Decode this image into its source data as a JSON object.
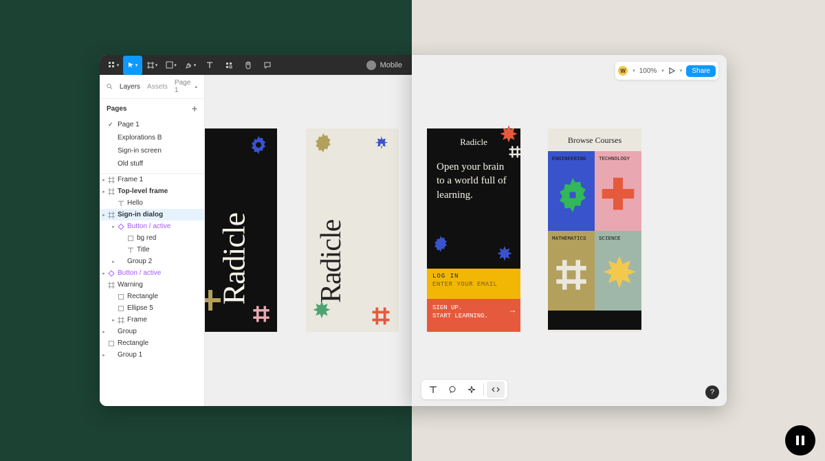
{
  "toolbar": {
    "project_name": "Mobile"
  },
  "left_tabs": {
    "layers": "Layers",
    "assets": "Assets",
    "page_selector": "Page 1"
  },
  "pages": {
    "title": "Pages",
    "items": [
      {
        "label": "Page 1",
        "active": true
      },
      {
        "label": "Explorations B",
        "active": false
      },
      {
        "label": "Sign-in screen",
        "active": false
      },
      {
        "label": "Old stuff",
        "active": false
      }
    ]
  },
  "layers": [
    {
      "label": "Frame 1",
      "depth": 0,
      "icon": "frame",
      "bold": false,
      "disc": true
    },
    {
      "label": "Top-level frame",
      "depth": 0,
      "icon": "frame",
      "bold": true,
      "disc": true
    },
    {
      "label": "Hello",
      "depth": 1,
      "icon": "text",
      "bold": false
    },
    {
      "label": "Sign-in dialog",
      "depth": 0,
      "icon": "frame",
      "bold": true,
      "selected": true,
      "disc": true
    },
    {
      "label": "Button / active",
      "depth": 1,
      "icon": "component",
      "bold": false,
      "purple": true,
      "disc": true
    },
    {
      "label": "bg red",
      "depth": 2,
      "icon": "rect",
      "bold": false
    },
    {
      "label": "Title",
      "depth": 2,
      "icon": "text",
      "bold": false
    },
    {
      "label": "Group 2",
      "depth": 1,
      "icon": "none",
      "bold": false,
      "disc": true
    },
    {
      "label": "Button / active",
      "depth": 0,
      "icon": "component",
      "bold": false,
      "purple": true,
      "disc": true
    },
    {
      "label": "Warning",
      "depth": 0,
      "icon": "frame",
      "bold": false
    },
    {
      "label": "Rectangle",
      "depth": 1,
      "icon": "rect",
      "bold": false
    },
    {
      "label": "Ellipse 5",
      "depth": 1,
      "icon": "rect",
      "bold": false
    },
    {
      "label": "Frame",
      "depth": 1,
      "icon": "frame",
      "bold": false,
      "disc": true
    },
    {
      "label": "Group",
      "depth": 0,
      "icon": "none",
      "bold": false,
      "disc": true
    },
    {
      "label": "Rectangle",
      "depth": 0,
      "icon": "rect",
      "bold": false
    },
    {
      "label": "Group 1",
      "depth": 0,
      "icon": "none",
      "bold": false,
      "disc": true
    }
  ],
  "viewer": {
    "badge": "W",
    "zoom": "100%",
    "share": "Share"
  },
  "canvas": {
    "radicle": "Radicle",
    "frame3": {
      "brand": "Radicle",
      "headline": "Open your brain to a world full of learning.",
      "login_label": "LOG IN",
      "login_placeholder": "ENTER YOUR EMAIL",
      "signup_line1": "SIGN UP.",
      "signup_line2": "START LEARNING."
    },
    "frame4": {
      "title": "Browse Courses",
      "cells": {
        "engineering": "ENGINEERING",
        "technology": "TECHNOLOGY",
        "mathematics": "MATHEMATICS",
        "science": "SCIENCE"
      }
    }
  },
  "help": "?",
  "colors": {
    "figma_blue": "#0d99ff",
    "dark_green": "#1c4233",
    "beige": "#e5e1da",
    "yellow": "#f2b705",
    "orange": "#e55a3c",
    "royal_blue": "#3853cc",
    "pink": "#e9a8b1",
    "olive": "#b3a05c",
    "sage": "#9fb7a8"
  }
}
